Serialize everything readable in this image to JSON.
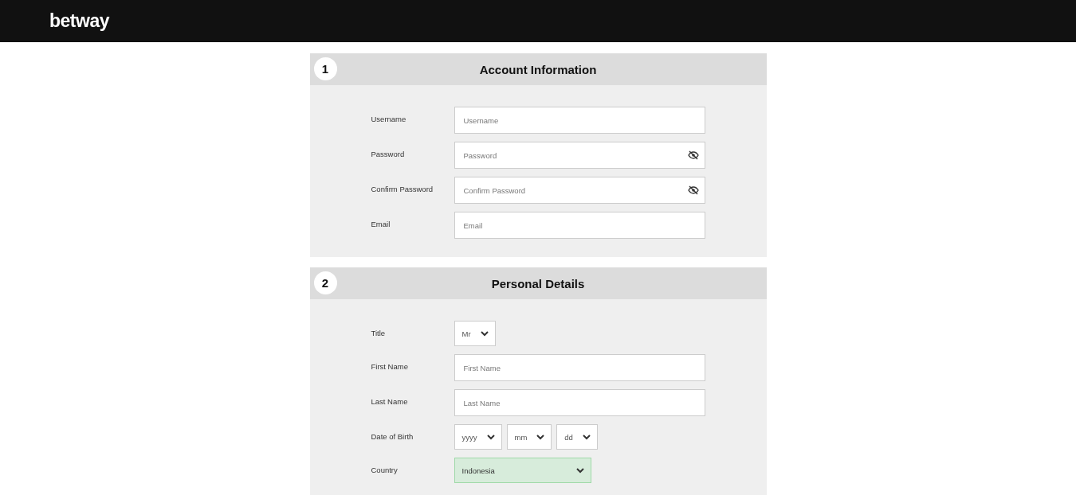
{
  "header": {
    "logo": "betway"
  },
  "sections": [
    {
      "number": "1",
      "title": "Account Information",
      "rows": [
        {
          "label": "Username",
          "controls": [
            {
              "kind": "input",
              "placeholder": "Username",
              "visibility_toggle": false
            }
          ]
        },
        {
          "label": "Password",
          "controls": [
            {
              "kind": "input",
              "placeholder": "Password",
              "visibility_toggle": true
            }
          ]
        },
        {
          "label": "Confirm Password",
          "controls": [
            {
              "kind": "input",
              "placeholder": "Confirm Password",
              "visibility_toggle": true
            }
          ]
        },
        {
          "label": "Email",
          "controls": [
            {
              "kind": "input",
              "placeholder": "Email",
              "visibility_toggle": false
            }
          ]
        }
      ]
    },
    {
      "number": "2",
      "title": "Personal Details",
      "rows": [
        {
          "label": "Title",
          "controls": [
            {
              "kind": "select",
              "value": "Mr",
              "valid": false
            }
          ]
        },
        {
          "label": "First Name",
          "controls": [
            {
              "kind": "input",
              "placeholder": "First Name",
              "visibility_toggle": false
            }
          ]
        },
        {
          "label": "Last Name",
          "controls": [
            {
              "kind": "input",
              "placeholder": "Last Name",
              "visibility_toggle": false
            }
          ]
        },
        {
          "label": "Date of Birth",
          "controls": [
            {
              "kind": "select",
              "value": "yyyy",
              "valid": false
            },
            {
              "kind": "select",
              "value": "mm",
              "valid": false
            },
            {
              "kind": "select",
              "value": "dd",
              "valid": false
            }
          ]
        },
        {
          "label": "Country",
          "controls": [
            {
              "kind": "select",
              "value": "Indonesia",
              "valid": true
            }
          ]
        }
      ]
    }
  ]
}
